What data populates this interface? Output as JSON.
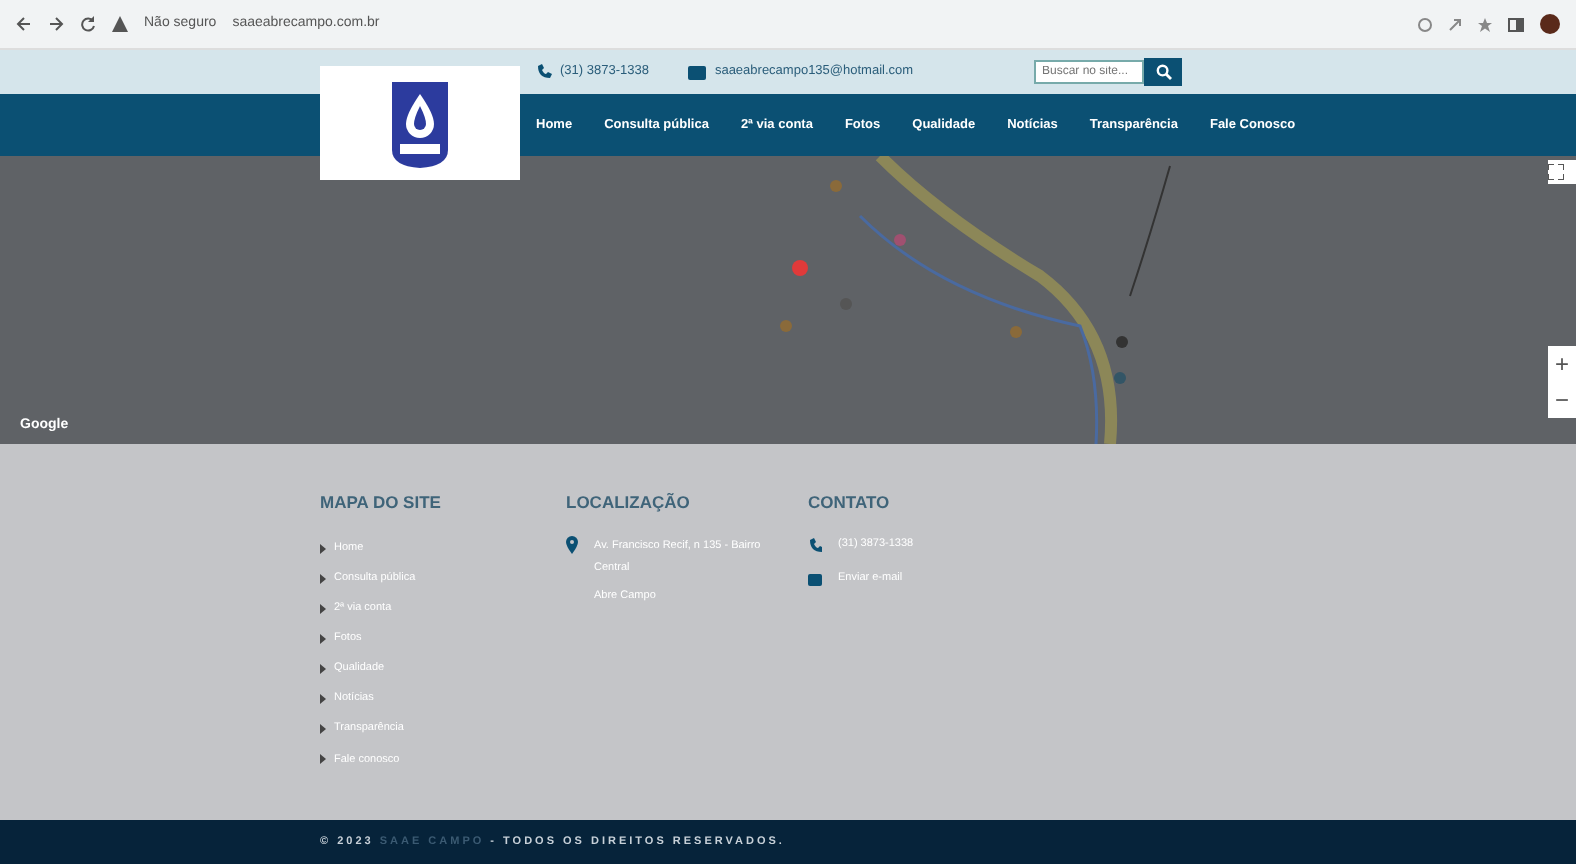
{
  "browser": {
    "security": "Não seguro",
    "url": "saaeabrecampo.com.br"
  },
  "topbar": {
    "phone": "(31) 3873-1338",
    "email": "saaeabrecampo135@hotmail.com",
    "search": {
      "placeholder": "Buscar no site..."
    }
  },
  "nav": [
    {
      "label": "Home"
    },
    {
      "label": "Consulta pública"
    },
    {
      "label": "2ª via conta"
    },
    {
      "label": "Fotos"
    },
    {
      "label": "Qualidade"
    },
    {
      "label": "Notícias"
    },
    {
      "label": "Transparência"
    },
    {
      "label": "Fale Conosco"
    }
  ],
  "map": {
    "kind": "picture",
    "brand": "Google",
    "zoom_in": "+",
    "zoom_out": "−"
  },
  "footer": {
    "sitemap": {
      "title": "MAPA DO SITE",
      "items": [
        "Home",
        "Consulta pública",
        "2ª via conta",
        "Fotos",
        "Qualidade",
        "Notícias",
        "Transparência",
        "Fale conosco"
      ]
    },
    "location": {
      "title": "LOCALIZAÇÃO",
      "lines": [
        "Av. Francisco Recif, n 135 - Bairro Central",
        "Abre Campo"
      ]
    },
    "contact": {
      "title": "CONTATO",
      "phone": "(31) 3873-1338",
      "email": "Enviar e-mail"
    }
  },
  "copyright": {
    "prefix": "© 2023",
    "brand": "SAAE CAMPO",
    "suffix": "- TODOS OS DIREITOS RESERVADOS."
  }
}
